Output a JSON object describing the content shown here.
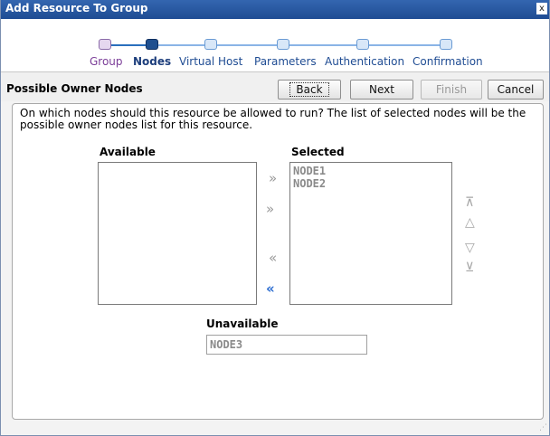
{
  "window": {
    "title": "Add Resource To Group",
    "close_glyph": "x"
  },
  "wizard": {
    "steps": [
      {
        "label": "Group",
        "state": "done"
      },
      {
        "label": "Nodes",
        "state": "current"
      },
      {
        "label": "Virtual Host",
        "state": "todo"
      },
      {
        "label": "Parameters",
        "state": "todo"
      },
      {
        "label": "Authentication",
        "state": "todo"
      },
      {
        "label": "Confirmation",
        "state": "todo"
      }
    ]
  },
  "page": {
    "heading": "Possible Owner Nodes",
    "instructions": "On which nodes should this resource be allowed to run?  The list of selected nodes will be the possible owner nodes list for this resource."
  },
  "buttons": {
    "back": "Back",
    "next": "Next",
    "finish": "Finish",
    "cancel": "Cancel"
  },
  "available": {
    "label": "Available",
    "items": []
  },
  "selected": {
    "label": "Selected",
    "items": [
      "NODE1",
      "NODE2"
    ]
  },
  "unavailable": {
    "label": "Unavailable",
    "value": "NODE3"
  },
  "controls": {
    "move_right": "»",
    "move_all_right": "»",
    "move_left": "«",
    "move_all_left": "«",
    "move_top": "⊼",
    "move_up": "△",
    "move_down": "▽",
    "move_bottom": "⊻"
  },
  "colors": {
    "titlebar": "#1f4c93",
    "active_arrow": "#2a6bd0",
    "current_step": "#1f4f8f",
    "done_step": "#7b3d98"
  }
}
